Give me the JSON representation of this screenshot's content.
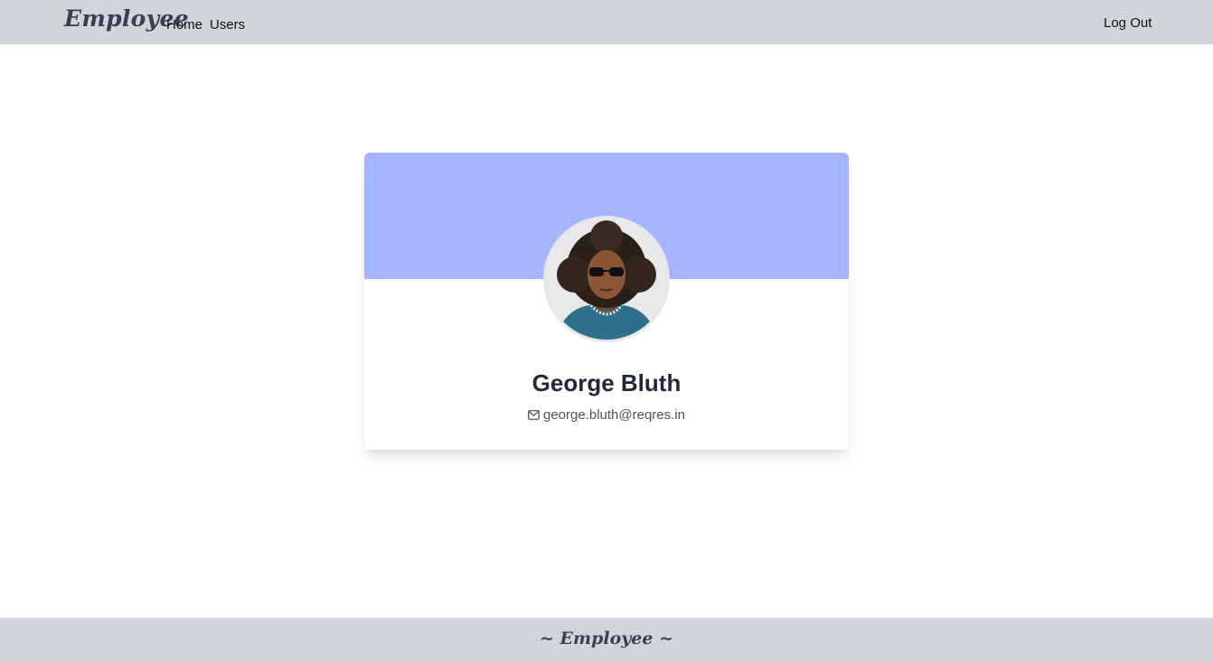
{
  "navbar": {
    "brand": "Employee",
    "links": [
      {
        "label": "Home"
      },
      {
        "label": "Users"
      }
    ],
    "logout_label": "Log Out"
  },
  "profile": {
    "name": "George Bluth",
    "email": "george.bluth@reqres.in",
    "icons": {
      "email": "mail-icon",
      "avatar": "avatar-photo"
    }
  },
  "colors": {
    "navbar_bg": "#d1d5db",
    "banner_bg": "#a5b4fc",
    "name_text": "#1f2937"
  },
  "footer": {
    "text": "~ Employee ~"
  }
}
